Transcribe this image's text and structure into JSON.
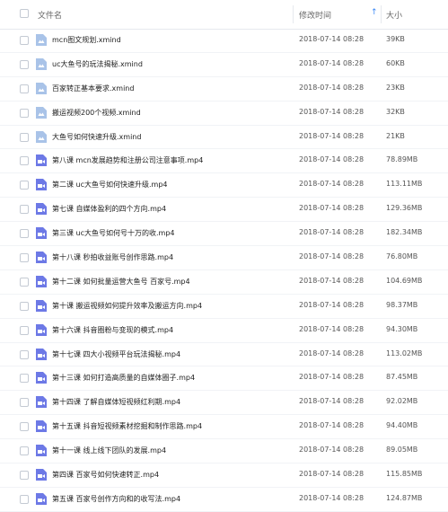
{
  "header": {
    "name_label": "文件名",
    "time_label": "修改时间",
    "size_label": "大小",
    "sort_indicator": "↑"
  },
  "icon_colors": {
    "xmind": "#a9c3e8",
    "video": "#6d79e6"
  },
  "files": [
    {
      "name": "mcn图文规划.xmind",
      "time": "2018-07-14 08:28",
      "size": "39KB",
      "type": "xmind"
    },
    {
      "name": "uc大鱼号的玩法揭秘.xmind",
      "time": "2018-07-14 08:28",
      "size": "60KB",
      "type": "xmind"
    },
    {
      "name": "百家转正基本要求.xmind",
      "time": "2018-07-14 08:28",
      "size": "23KB",
      "type": "xmind"
    },
    {
      "name": "搬运视频200个视频.xmind",
      "time": "2018-07-14 08:28",
      "size": "32KB",
      "type": "xmind"
    },
    {
      "name": "大鱼号如何快速升级.xmind",
      "time": "2018-07-14 08:28",
      "size": "21KB",
      "type": "xmind"
    },
    {
      "name": "第八课 mcn发展趋势和注册公司注意事项.mp4",
      "time": "2018-07-14 08:28",
      "size": "78.89MB",
      "type": "video"
    },
    {
      "name": "第二课 uc大鱼号如何快速升级.mp4",
      "time": "2018-07-14 08:28",
      "size": "113.11MB",
      "type": "video"
    },
    {
      "name": "第七课 自媒体盈利的四个方向.mp4",
      "time": "2018-07-14 08:28",
      "size": "129.36MB",
      "type": "video"
    },
    {
      "name": "第三课 uc大鱼号如何号十万的收.mp4",
      "time": "2018-07-14 08:28",
      "size": "182.34MB",
      "type": "video"
    },
    {
      "name": "第十八课 秒拍收益账号创作思路.mp4",
      "time": "2018-07-14 08:28",
      "size": "76.80MB",
      "type": "video"
    },
    {
      "name": "第十二课 如何批量运营大鱼号 百家号.mp4",
      "time": "2018-07-14 08:28",
      "size": "104.69MB",
      "type": "video"
    },
    {
      "name": "第十课 搬运视频如何提升效率及搬运方向.mp4",
      "time": "2018-07-14 08:28",
      "size": "98.37MB",
      "type": "video"
    },
    {
      "name": "第十六课 抖音圈粉与变现的模式.mp4",
      "time": "2018-07-14 08:28",
      "size": "94.30MB",
      "type": "video"
    },
    {
      "name": "第十七课 四大小视频平台玩法揭秘.mp4",
      "time": "2018-07-14 08:28",
      "size": "113.02MB",
      "type": "video"
    },
    {
      "name": "第十三课 如何打造高质量的自媒体圈子.mp4",
      "time": "2018-07-14 08:28",
      "size": "87.45MB",
      "type": "video"
    },
    {
      "name": "第十四课 了解自媒体短视频红利期.mp4",
      "time": "2018-07-14 08:28",
      "size": "92.02MB",
      "type": "video"
    },
    {
      "name": "第十五课 抖音短视频素材挖掘和制作思路.mp4",
      "time": "2018-07-14 08:28",
      "size": "94.40MB",
      "type": "video"
    },
    {
      "name": "第十一课 线上线下团队的发展.mp4",
      "time": "2018-07-14 08:28",
      "size": "89.05MB",
      "type": "video"
    },
    {
      "name": "第四课 百家号如何快速转正.mp4",
      "time": "2018-07-14 08:28",
      "size": "115.85MB",
      "type": "video"
    },
    {
      "name": "第五课 百家号创作方向和的收写法.mp4",
      "time": "2018-07-14 08:28",
      "size": "124.87MB",
      "type": "video"
    }
  ]
}
